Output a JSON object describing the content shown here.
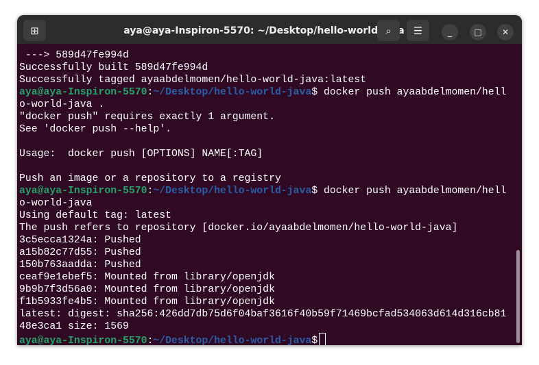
{
  "window": {
    "title": "aya@aya-Inspiron-5570: ~/Desktop/hello-world-java"
  },
  "prompt": {
    "user": "aya@aya-Inspiron-5570",
    "sep": ":",
    "path": "~/Desktop/hello-world-java",
    "symbol": "$"
  },
  "lines": {
    "l0": " ---> 589d47fe994d",
    "l1": "Successfully built 589d47fe994d",
    "l2": "Successfully tagged ayaabdelmomen/hello-world-java:latest",
    "cmd1": " docker push ayaabdelmomen/hell",
    "cmd1b": "o-world-java .",
    "l5": "\"docker push\" requires exactly 1 argument.",
    "l6": "See 'docker push --help'.",
    "l7": "",
    "l8": "Usage:  docker push [OPTIONS] NAME[:TAG]",
    "l9": "",
    "l10": "Push an image or a repository to a registry",
    "cmd2": " docker push ayaabdelmomen/hell",
    "cmd2b": "o-world-java",
    "l13": "Using default tag: latest",
    "l14": "The push refers to repository [docker.io/ayaabdelmomen/hello-world-java]",
    "l15": "3c5ecca1324a: Pushed",
    "l16": "a15b82c77d55: Pushed",
    "l17": "150b763aadda: Pushed",
    "l18": "ceaf9e1ebef5: Mounted from library/openjdk",
    "l19": "9b9b7f3d56a0: Mounted from library/openjdk",
    "l20": "f1b5933fe4b5: Mounted from library/openjdk",
    "l21": "latest: digest: sha256:426dd7db75d6f04baf3616f40b59f71469bcfad534063d614d316cb81",
    "l22": "48e3ca1 size: 1569"
  }
}
